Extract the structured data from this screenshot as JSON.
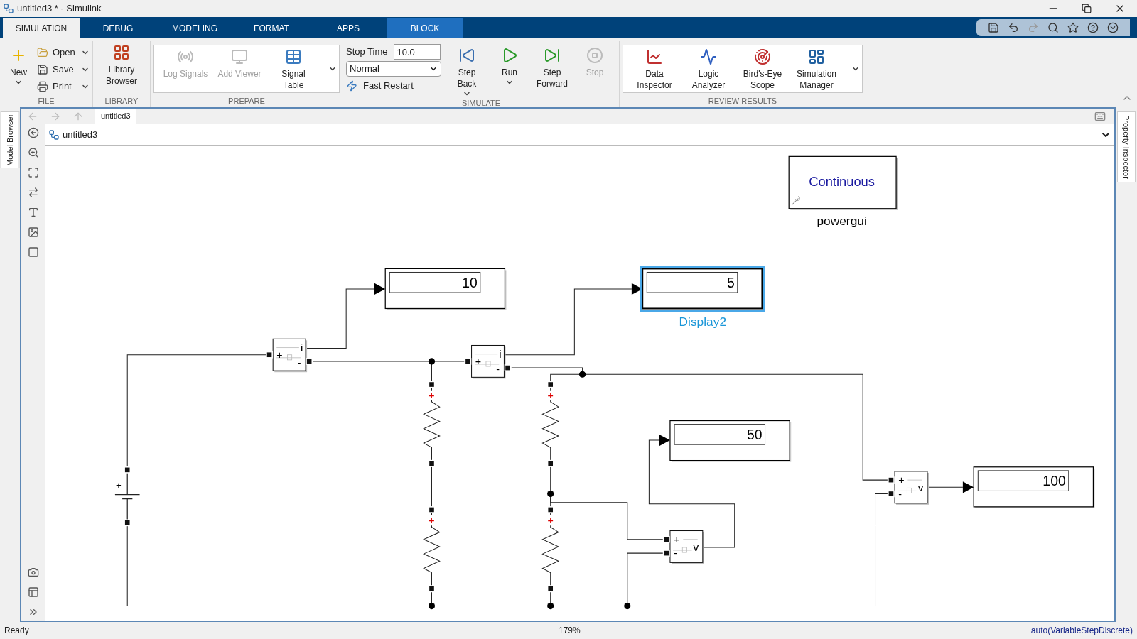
{
  "window": {
    "title": "untitled3 * - Simulink"
  },
  "tabs": [
    {
      "label": "SIMULATION",
      "selected": true,
      "kind": "standard"
    },
    {
      "label": "DEBUG",
      "selected": false,
      "kind": "standard"
    },
    {
      "label": "MODELING",
      "selected": false,
      "kind": "standard"
    },
    {
      "label": "FORMAT",
      "selected": false,
      "kind": "standard"
    },
    {
      "label": "APPS",
      "selected": false,
      "kind": "standard"
    },
    {
      "label": "BLOCK",
      "selected": false,
      "kind": "contextual"
    }
  ],
  "ribbon": [
    {
      "title": "FILE",
      "kind": "file",
      "buttons": [
        {
          "kind": "large",
          "label": "New",
          "dropdown": true,
          "disabled": false
        },
        {
          "kind": "small",
          "label": "Open",
          "dropdown": true,
          "disabled": false
        },
        {
          "kind": "small",
          "label": "Save",
          "dropdown": true,
          "disabled": false
        },
        {
          "kind": "small",
          "label": "Print",
          "dropdown": true,
          "disabled": false
        }
      ]
    },
    {
      "title": "LIBRARY",
      "kind": "plain",
      "buttons": [
        {
          "kind": "large",
          "label": "Library Browser",
          "dropdown": false,
          "disabled": false
        }
      ]
    },
    {
      "title": "PREPARE",
      "kind": "gallery",
      "buttons": [
        {
          "kind": "large",
          "label": "Log Signals",
          "dropdown": false,
          "disabled": true
        },
        {
          "kind": "large",
          "label": "Add Viewer",
          "dropdown": false,
          "disabled": true
        },
        {
          "kind": "large",
          "label": "Signal Table",
          "dropdown": false,
          "disabled": false
        }
      ]
    },
    {
      "title": "SIMULATE",
      "kind": "simulate",
      "stop_time": {
        "label": "Stop Time",
        "value": "10.0"
      },
      "mode": {
        "value": "Normal"
      },
      "fast_restart": {
        "label": "Fast Restart"
      },
      "buttons": [
        {
          "kind": "large",
          "label": "Step Back",
          "dropdown": true,
          "disabled": false
        },
        {
          "kind": "large",
          "label": "Run",
          "dropdown": true,
          "disabled": false
        },
        {
          "kind": "large",
          "label": "Step Forward",
          "dropdown": false,
          "disabled": false
        },
        {
          "kind": "large",
          "label": "Stop",
          "dropdown": false,
          "disabled": true
        }
      ]
    },
    {
      "title": "REVIEW RESULTS",
      "kind": "gallery",
      "buttons": [
        {
          "kind": "large",
          "label": "Data Inspector",
          "dropdown": false,
          "disabled": false
        },
        {
          "kind": "large",
          "label": "Logic Analyzer",
          "dropdown": false,
          "disabled": false
        },
        {
          "kind": "large",
          "label": "Bird's-Eye Scope",
          "dropdown": false,
          "disabled": false
        },
        {
          "kind": "large",
          "label": "Simulation Manager",
          "dropdown": false,
          "disabled": false
        }
      ]
    }
  ],
  "side_tabs": {
    "left": "Model Browser",
    "right": "Property Inspector"
  },
  "editor": {
    "tab": "untitled3",
    "breadcrumb": "untitled3"
  },
  "canvas": {
    "powergui": {
      "mode": "Continuous",
      "label": "powergui"
    },
    "displays": [
      {
        "value": "10",
        "selected": false
      },
      {
        "value": "5",
        "selected": true,
        "label": "Display2"
      },
      {
        "value": "50",
        "selected": false
      },
      {
        "value": "100",
        "selected": false
      }
    ],
    "sensors": [
      {
        "kind": "current",
        "plus": "+",
        "minus": "-",
        "output": "i"
      },
      {
        "kind": "current",
        "plus": "+",
        "minus": "-",
        "output": "i"
      },
      {
        "kind": "voltage",
        "plus": "+",
        "minus": "-",
        "output": "v"
      },
      {
        "kind": "voltage",
        "plus": "+",
        "minus": "-",
        "output": "v"
      }
    ],
    "battery": {
      "plus": "+"
    },
    "resistors": [
      {
        "plus": "+"
      },
      {
        "plus": "+"
      },
      {
        "plus": "+"
      },
      {
        "plus": "+"
      }
    ]
  },
  "status_bar": {
    "state": "Ready",
    "zoom": "179%",
    "solver": "auto(VariableStepDiscrete)"
  }
}
